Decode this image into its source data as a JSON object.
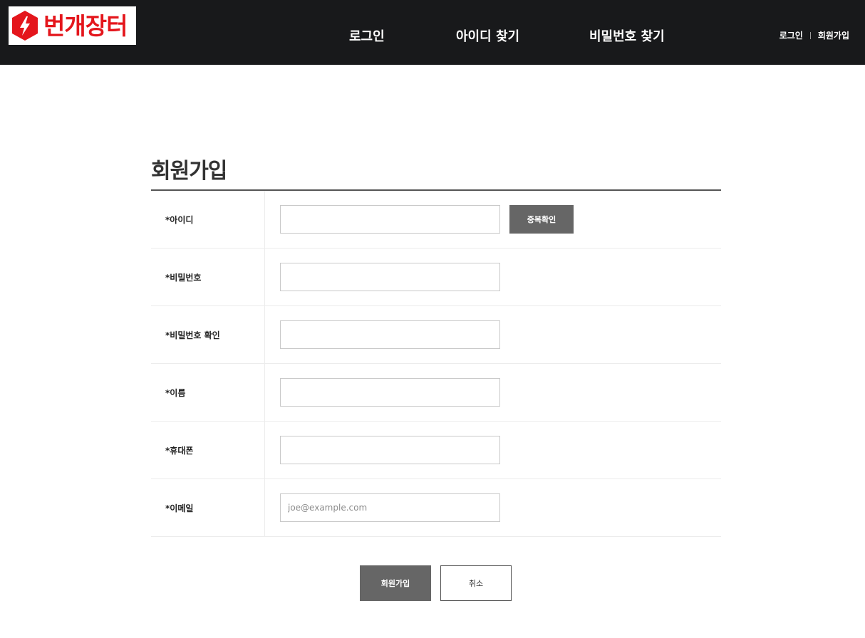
{
  "header": {
    "logo_text": "번개장터",
    "logo_icon": "lightning-bolt-icon",
    "brand_color": "#e4161c",
    "nav": [
      {
        "label": "로그인"
      },
      {
        "label": "아이디 찾기"
      },
      {
        "label": "비밀번호 찾기"
      }
    ],
    "util": {
      "login": "로그인",
      "join": "회원가입"
    }
  },
  "form": {
    "title": "회원가입",
    "fields": [
      {
        "label": "*아이디",
        "value": "",
        "placeholder": ""
      },
      {
        "label": "*비밀번호",
        "value": "",
        "placeholder": ""
      },
      {
        "label": "*비밀번호 확인",
        "value": "",
        "placeholder": ""
      },
      {
        "label": "*이름",
        "value": "",
        "placeholder": ""
      },
      {
        "label": "*휴대폰",
        "value": "",
        "placeholder": ""
      },
      {
        "label": "*이메일",
        "value": "",
        "placeholder": "joe@example.com"
      }
    ],
    "dup_check_label": "중복확인",
    "submit_label": "회원가입",
    "cancel_label": "취소"
  }
}
